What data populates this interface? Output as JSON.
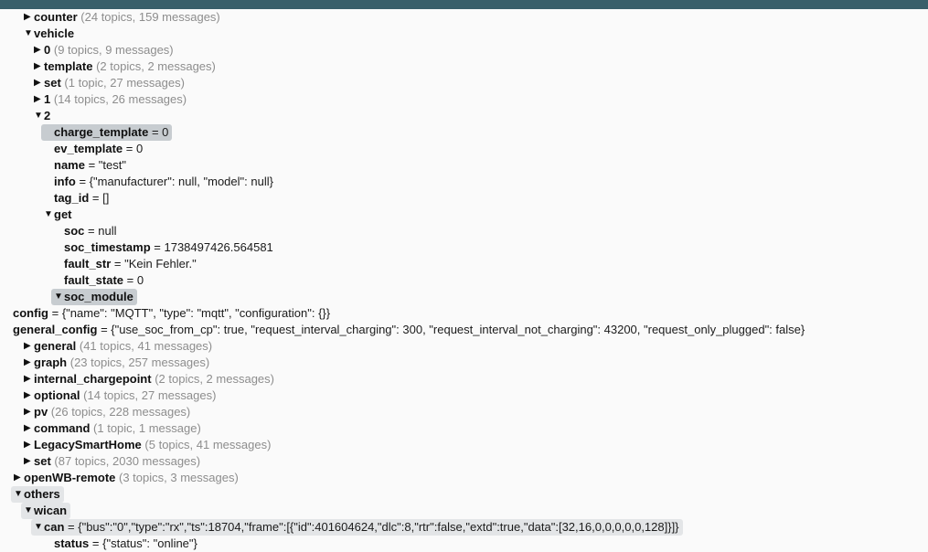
{
  "window": {
    "titlebar_color": "#395f6a",
    "background_color": "#fafafa",
    "highlight_strong_color": "#c7ccd0",
    "highlight_weak_color": "#e3e5e7"
  },
  "icons": {
    "collapsed": "▶",
    "expanded": "▼"
  },
  "tree": [
    {
      "depth": 0,
      "marker": "collapsed",
      "key": "counter",
      "meta": "(24 topics, 159 messages)",
      "highlight": "none"
    },
    {
      "depth": 0,
      "marker": "expanded",
      "key": "vehicle",
      "meta": "",
      "highlight": "none"
    },
    {
      "depth": 1,
      "marker": "collapsed",
      "key": "0",
      "meta": "(9 topics, 9 messages)",
      "highlight": "none"
    },
    {
      "depth": 1,
      "marker": "collapsed",
      "key": "template",
      "meta": "(2 topics, 2 messages)",
      "highlight": "none"
    },
    {
      "depth": 1,
      "marker": "collapsed",
      "key": "set",
      "meta": "(1 topic, 27 messages)",
      "highlight": "none"
    },
    {
      "depth": 1,
      "marker": "collapsed",
      "key": "1",
      "meta": "(14 topics, 26 messages)",
      "highlight": "none"
    },
    {
      "depth": 1,
      "marker": "expanded",
      "key": "2",
      "meta": "",
      "highlight": "none"
    },
    {
      "depth": 2,
      "marker": "none",
      "key": "charge_template",
      "eq": " = ",
      "value": "0",
      "highlight": "strong"
    },
    {
      "depth": 2,
      "marker": "none",
      "key": "ev_template",
      "eq": " = ",
      "value": "0",
      "highlight": "none"
    },
    {
      "depth": 2,
      "marker": "none",
      "key": "name",
      "eq": " = ",
      "value": "\"test\"",
      "highlight": "none"
    },
    {
      "depth": 2,
      "marker": "none",
      "key": "info",
      "eq": " = ",
      "value": "{\"manufacturer\": null, \"model\": null}",
      "highlight": "none"
    },
    {
      "depth": 2,
      "marker": "none",
      "key": "tag_id",
      "eq": " = ",
      "value": "[]",
      "highlight": "none"
    },
    {
      "depth": 2,
      "marker": "expanded",
      "key": "get",
      "meta": "",
      "highlight": "none"
    },
    {
      "depth": 3,
      "marker": "none",
      "key": "soc",
      "eq": " = ",
      "value": "null",
      "highlight": "none"
    },
    {
      "depth": 3,
      "marker": "none",
      "key": "soc_timestamp",
      "eq": " = ",
      "value": "1738497426.564581",
      "highlight": "none"
    },
    {
      "depth": 3,
      "marker": "none",
      "key": "fault_str",
      "eq": " = ",
      "value": "\"Kein Fehler.\"",
      "highlight": "none"
    },
    {
      "depth": 3,
      "marker": "none",
      "key": "fault_state",
      "eq": " = ",
      "value": "0",
      "highlight": "none"
    },
    {
      "depth": 3,
      "marker": "expanded",
      "key": "soc_module",
      "meta": "",
      "highlight": "strong"
    },
    {
      "depth": 4,
      "marker": "none",
      "key": "config",
      "eq": " = ",
      "value": "{\"name\": \"MQTT\", \"type\": \"mqtt\", \"configuration\": {}}",
      "highlight": "none"
    },
    {
      "depth": 4,
      "marker": "none",
      "key": "general_config",
      "eq": " = ",
      "value": "{\"use_soc_from_cp\": true, \"request_interval_charging\": 300, \"request_interval_not_charging\": 43200, \"request_only_plugged\": false}",
      "highlight": "none"
    },
    {
      "depth": 0,
      "marker": "collapsed",
      "key": "general",
      "meta": "(41 topics, 41 messages)",
      "highlight": "none"
    },
    {
      "depth": 0,
      "marker": "collapsed",
      "key": "graph",
      "meta": "(23 topics, 257 messages)",
      "highlight": "none"
    },
    {
      "depth": 0,
      "marker": "collapsed",
      "key": "internal_chargepoint",
      "meta": "(2 topics, 2 messages)",
      "highlight": "none"
    },
    {
      "depth": 0,
      "marker": "collapsed",
      "key": "optional",
      "meta": "(14 topics, 27 messages)",
      "highlight": "none"
    },
    {
      "depth": 0,
      "marker": "collapsed",
      "key": "pv",
      "meta": "(26 topics, 228 messages)",
      "highlight": "none"
    },
    {
      "depth": 0,
      "marker": "collapsed",
      "key": "command",
      "meta": "(1 topic, 1 message)",
      "highlight": "none"
    },
    {
      "depth": 0,
      "marker": "collapsed",
      "key": "LegacySmartHome",
      "meta": "(5 topics, 41 messages)",
      "highlight": "none"
    },
    {
      "depth": 0,
      "marker": "collapsed",
      "key": "set",
      "meta": "(87 topics, 2030 messages)",
      "highlight": "none"
    },
    {
      "depth": -1,
      "marker": "collapsed",
      "key": "openWB-remote",
      "meta": "(3 topics, 3 messages)",
      "highlight": "none"
    },
    {
      "depth": -1,
      "marker": "expanded",
      "key": "others",
      "meta": "",
      "highlight": "weak"
    },
    {
      "depth": 0,
      "marker": "expanded",
      "key": "wican",
      "meta": "",
      "highlight": "weak"
    },
    {
      "depth": 1,
      "marker": "expanded",
      "key": "can",
      "eq": " = ",
      "value": "{\"bus\":\"0\",\"type\":\"rx\",\"ts\":18704,\"frame\":[{\"id\":401604624,\"dlc\":8,\"rtr\":false,\"extd\":true,\"data\":[32,16,0,0,0,0,0,128]}]}",
      "highlight": "weak"
    },
    {
      "depth": 2,
      "marker": "none",
      "key": "status",
      "eq": " = ",
      "value": "{\"status\": \"online\"}",
      "highlight": "none"
    }
  ]
}
